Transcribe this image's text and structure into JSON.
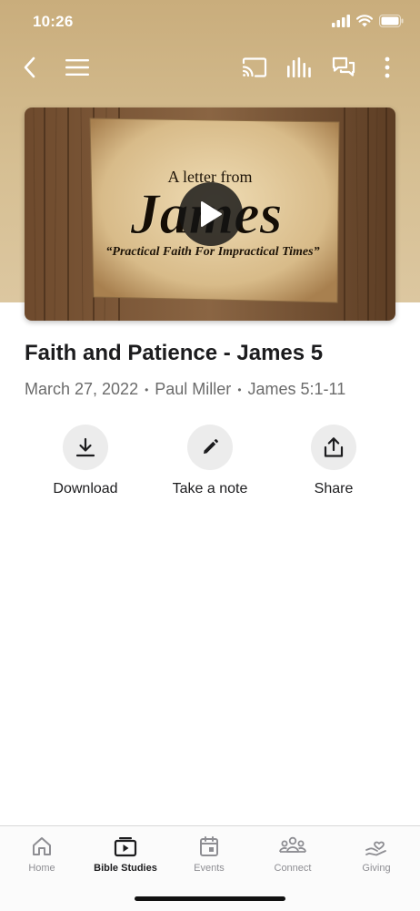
{
  "status_bar": {
    "time": "10:26"
  },
  "toolbar": {
    "back_icon": "chevron-left-icon",
    "menu_icon": "hamburger-menu-icon",
    "cast_icon": "cast-icon",
    "audio_icon": "audio-bars-icon",
    "chat_icon": "chat-bubbles-icon",
    "more_icon": "more-vertical-icon"
  },
  "video": {
    "line1": "A letter from",
    "line2": "James",
    "line3": "“Practical Faith For Impractical Times”",
    "play_icon": "play-icon"
  },
  "sermon": {
    "title": "Faith and Patience - James 5",
    "date": "March 27, 2022",
    "speaker": "Paul Miller",
    "passage": "James 5:1-11",
    "separator": "•"
  },
  "actions": [
    {
      "label": "Download",
      "icon": "download-icon"
    },
    {
      "label": "Take a note",
      "icon": "pencil-icon"
    },
    {
      "label": "Share",
      "icon": "share-icon"
    }
  ],
  "tabs": [
    {
      "label": "Home",
      "icon": "home-icon",
      "active": false
    },
    {
      "label": "Bible Studies",
      "icon": "video-library-icon",
      "active": true
    },
    {
      "label": "Events",
      "icon": "calendar-icon",
      "active": false
    },
    {
      "label": "Connect",
      "icon": "people-icon",
      "active": false
    },
    {
      "label": "Giving",
      "icon": "giving-hand-icon",
      "active": false
    }
  ],
  "colors": {
    "hero_background": "#d4bb8e",
    "text_primary": "#1c1c1e",
    "text_secondary": "#6b6b6b",
    "action_circle": "#ececec",
    "tab_inactive": "#8e8e93"
  }
}
